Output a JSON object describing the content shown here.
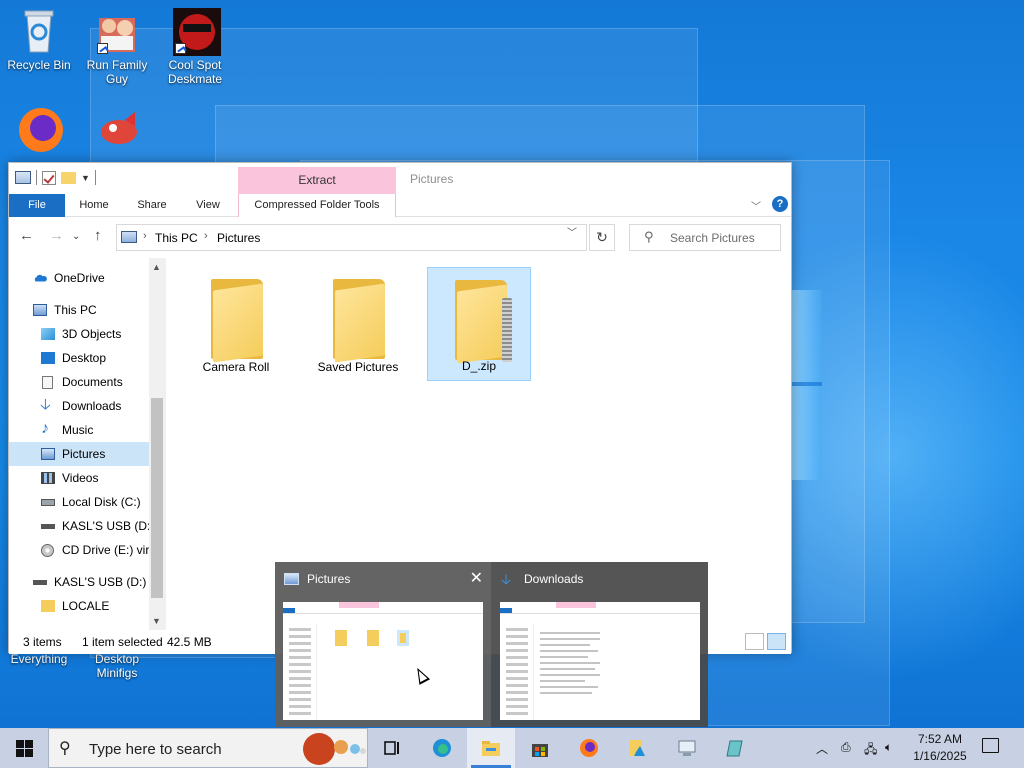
{
  "desktop": {
    "icons": [
      {
        "label": "Recycle Bin"
      },
      {
        "label": "Run Family Guy"
      },
      {
        "label": "Cool Spot Deskmate"
      },
      {
        "label": "Everything"
      },
      {
        "label": "Desktop Minifigs"
      }
    ]
  },
  "explorer": {
    "ribbon_context_tab": "Extract",
    "window_title": "Pictures",
    "tabs": {
      "file": "File",
      "home": "Home",
      "share": "Share",
      "view": "View",
      "context": "Compressed Folder Tools"
    },
    "help": "?",
    "breadcrumb": [
      "This PC",
      "Pictures"
    ],
    "search_placeholder": "Search Pictures",
    "nav": {
      "onedrive": "OneDrive",
      "thispc": "This PC",
      "objects3d": "3D Objects",
      "desktop": "Desktop",
      "documents": "Documents",
      "downloads": "Downloads",
      "music": "Music",
      "pictures": "Pictures",
      "videos": "Videos",
      "localdisk": "Local Disk (C:)",
      "usb1": "KASL'S USB (D:)",
      "cddrive": "CD Drive (E:) virt",
      "usb2": "KASL'S USB (D:)",
      "locale": "LOCALE"
    },
    "items": [
      {
        "name": "Camera Roll",
        "type": "folder"
      },
      {
        "name": "Saved Pictures",
        "type": "folder"
      },
      {
        "name": "D_.zip",
        "type": "zip",
        "selected": true
      }
    ],
    "status": {
      "count": "3 items",
      "selection": "1 item selected",
      "size": "42.5 MB"
    }
  },
  "taskbar_preview": {
    "windows": [
      {
        "title": "Pictures"
      },
      {
        "title": "Downloads"
      }
    ],
    "close_glyph": "✕"
  },
  "taskbar": {
    "search_placeholder": "Type here to search",
    "time": "7:52 AM",
    "date": "1/16/2025"
  },
  "colors": {
    "accent": "#1a6fc4",
    "context_tab": "#f9c4dc",
    "selection": "#cce8ff"
  }
}
